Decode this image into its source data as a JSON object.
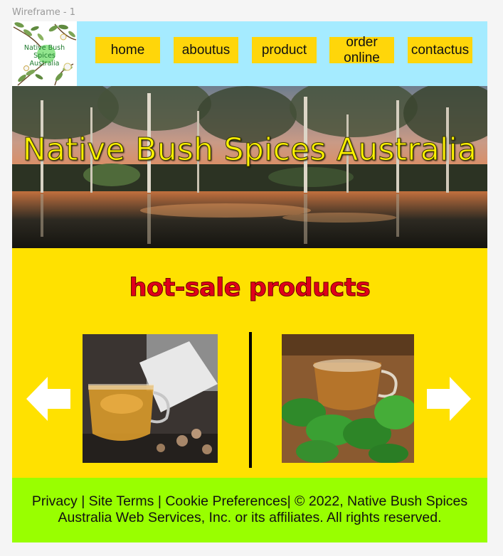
{
  "frame": {
    "label": "Wireframe - 1"
  },
  "header": {
    "logo_text_line1": "Native Bush Spices",
    "logo_text_line2": "Australia",
    "nav": {
      "home": "home",
      "aboutus": "aboutus",
      "product": "product",
      "order_line1": "order",
      "order_line2": "online",
      "contactus": "contactus"
    }
  },
  "hero": {
    "title": "Native Bush Spices Australia"
  },
  "main": {
    "title": "hot-sale products",
    "prev_icon": "arrow-left-icon",
    "next_icon": "arrow-right-icon"
  },
  "footer": {
    "line1": "Privacy | Site Terms | Cookie Preferences| ©  2022, Native Bush Spices",
    "line2": "Australia Web Services, Inc. or its affiliates. All rights reserved."
  },
  "colors": {
    "header_bg": "#a5ebff",
    "nav_button": "#ffd60a",
    "hero_title": "#fff200",
    "main_bg": "#ffe100",
    "section_title": "#e1001a",
    "footer_bg": "#99ff00"
  }
}
